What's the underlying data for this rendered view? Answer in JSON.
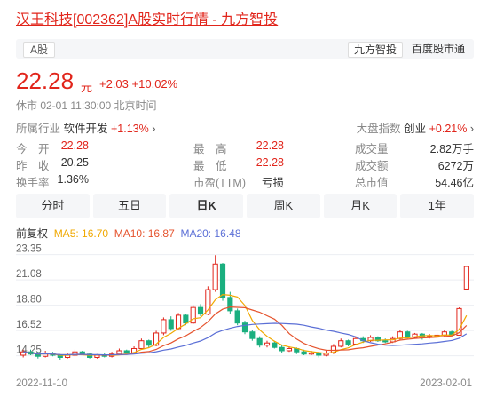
{
  "title": "汉王科技[002362]A股实时行情 - 九方智投",
  "market_tag": "A股",
  "brand_tag": "九方智投",
  "brand_link": "百度股市通",
  "price": "22.28",
  "price_unit": "元",
  "change": "+2.03",
  "change_pct": "+10.02%",
  "status": "休市  02-01 11:30:00  北京时间",
  "industry_label": "所属行业",
  "industry_name": "软件开发",
  "industry_change": "+1.13%",
  "index_label": "大盘指数",
  "index_name": "创业",
  "index_change": "+0.21%",
  "quotes": [
    {
      "label": "今　开",
      "value": "22.28",
      "red": true
    },
    {
      "label": "最　高",
      "value": "22.28",
      "red": true
    },
    {
      "label": "成交量",
      "value": "2.82万手",
      "red": false
    },
    {
      "label": "昨　收",
      "value": "20.25",
      "red": false
    },
    {
      "label": "最　低",
      "value": "22.28",
      "red": true
    },
    {
      "label": "成交额",
      "value": "6272万",
      "red": false
    },
    {
      "label": "换手率",
      "value": "1.36%",
      "red": false
    },
    {
      "label": "市盈(TTM)",
      "value": "亏损",
      "red": false
    },
    {
      "label": "总市值",
      "value": "54.46亿",
      "red": false
    }
  ],
  "periods": [
    "分时",
    "五日",
    "日K",
    "周K",
    "月K",
    "1年"
  ],
  "active_period": "日K",
  "legend": {
    "adj": "前复权",
    "ma5": "MA5: 16.70",
    "ma10": "MA10: 16.87",
    "ma20": "MA20: 16.48"
  },
  "colors": {
    "up": "#e1251b",
    "down": "#1aaf7f",
    "ma5": "#f0a800",
    "ma10": "#e5532d",
    "ma20": "#5b6fd6"
  },
  "chart_data": {
    "type": "candlestick",
    "y_ticks": [
      "23.35",
      "21.08",
      "18.80",
      "16.52",
      "14.25"
    ],
    "ylim": [
      13.9,
      23.8
    ],
    "x_labels": [
      "2022-11-10",
      "2023-02-01"
    ],
    "candles": [
      [
        14.3,
        14.6,
        14.1,
        14.8
      ],
      [
        14.6,
        14.4,
        14.3,
        14.8
      ],
      [
        14.4,
        14.2,
        14.0,
        14.6
      ],
      [
        14.2,
        14.5,
        14.1,
        14.7
      ],
      [
        14.5,
        14.3,
        14.2,
        14.6
      ],
      [
        14.3,
        14.1,
        13.9,
        14.4
      ],
      [
        14.1,
        14.3,
        14.0,
        14.5
      ],
      [
        14.3,
        14.6,
        14.2,
        14.8
      ],
      [
        14.6,
        14.4,
        14.3,
        14.7
      ],
      [
        14.4,
        14.1,
        14.0,
        14.5
      ],
      [
        14.1,
        14.3,
        14.0,
        14.4
      ],
      [
        14.3,
        14.2,
        14.1,
        14.5
      ],
      [
        14.2,
        14.4,
        14.1,
        14.6
      ],
      [
        14.4,
        14.7,
        14.3,
        14.9
      ],
      [
        14.7,
        14.5,
        14.4,
        14.8
      ],
      [
        14.5,
        14.9,
        14.4,
        15.1
      ],
      [
        14.9,
        15.6,
        14.8,
        15.8
      ],
      [
        15.6,
        15.2,
        15.0,
        15.7
      ],
      [
        15.2,
        16.3,
        15.1,
        16.5
      ],
      [
        16.3,
        17.5,
        16.1,
        17.7
      ],
      [
        17.5,
        16.7,
        16.5,
        17.8
      ],
      [
        16.7,
        17.9,
        16.6,
        18.1
      ],
      [
        17.9,
        17.2,
        17.0,
        18.0
      ],
      [
        17.2,
        18.6,
        17.1,
        18.8
      ],
      [
        18.6,
        18.0,
        17.8,
        18.9
      ],
      [
        18.0,
        20.2,
        17.9,
        20.5
      ],
      [
        20.2,
        22.5,
        20.0,
        23.3
      ],
      [
        22.5,
        19.5,
        19.2,
        22.6
      ],
      [
        19.5,
        18.3,
        18.0,
        20.0
      ],
      [
        18.3,
        17.2,
        17.0,
        18.5
      ],
      [
        17.2,
        16.4,
        16.2,
        17.4
      ],
      [
        16.4,
        15.8,
        15.6,
        16.6
      ],
      [
        15.8,
        15.2,
        15.0,
        16.0
      ],
      [
        15.2,
        15.4,
        15.0,
        15.6
      ],
      [
        15.4,
        15.0,
        14.9,
        15.6
      ],
      [
        15.0,
        14.7,
        14.5,
        15.2
      ],
      [
        14.7,
        14.9,
        14.6,
        15.1
      ],
      [
        14.9,
        14.6,
        14.4,
        15.0
      ],
      [
        14.6,
        14.4,
        14.3,
        14.8
      ],
      [
        14.4,
        14.5,
        14.3,
        14.7
      ],
      [
        14.5,
        14.3,
        14.1,
        14.6
      ],
      [
        14.3,
        14.5,
        14.2,
        14.7
      ],
      [
        14.5,
        15.1,
        14.4,
        15.3
      ],
      [
        15.1,
        15.6,
        15.0,
        15.8
      ],
      [
        15.6,
        15.3,
        15.1,
        15.7
      ],
      [
        15.3,
        15.8,
        15.2,
        16.0
      ],
      [
        15.8,
        15.6,
        15.4,
        16.0
      ],
      [
        15.6,
        15.9,
        15.5,
        16.1
      ],
      [
        15.9,
        15.6,
        15.5,
        16.0
      ],
      [
        15.6,
        15.5,
        15.4,
        15.8
      ],
      [
        15.5,
        15.8,
        15.4,
        16.0
      ],
      [
        15.8,
        16.4,
        15.7,
        16.6
      ],
      [
        16.4,
        15.9,
        15.8,
        16.5
      ],
      [
        15.9,
        16.2,
        15.8,
        16.3
      ],
      [
        16.2,
        15.9,
        15.7,
        16.3
      ],
      [
        15.9,
        16.0,
        15.8,
        16.2
      ],
      [
        16.0,
        16.1,
        15.9,
        16.3
      ],
      [
        16.1,
        16.4,
        16.0,
        16.6
      ],
      [
        16.4,
        16.1,
        16.0,
        16.5
      ],
      [
        16.1,
        18.5,
        16.1,
        18.6
      ],
      [
        20.25,
        22.28,
        20.25,
        22.28
      ]
    ]
  }
}
